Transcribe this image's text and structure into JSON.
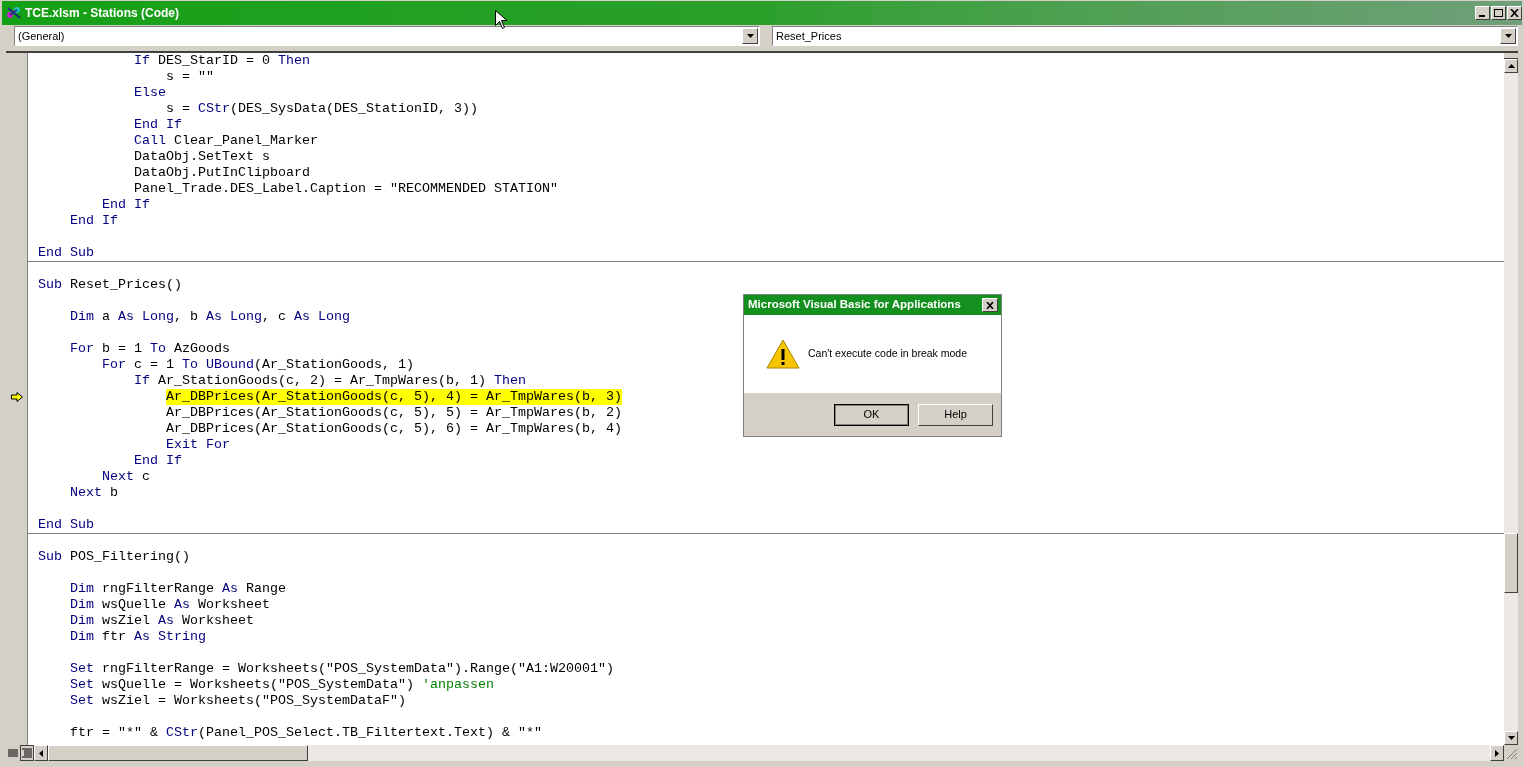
{
  "window": {
    "title": "TCE.xlsm - Stations (Code)"
  },
  "object_box": {
    "value": "(General)"
  },
  "procedure_box": {
    "value": "Reset_Prices"
  },
  "procedures": [
    {
      "lines": [
        {
          "current": false,
          "segments": [
            {
              "kind": "keyword",
              "text": "            If "
            },
            {
              "kind": "plain",
              "text": "DES_StarID = 0 "
            },
            {
              "kind": "keyword",
              "text": "Then"
            }
          ]
        },
        {
          "current": false,
          "segments": [
            {
              "kind": "plain",
              "text": "                s = \"\""
            }
          ]
        },
        {
          "current": false,
          "segments": [
            {
              "kind": "keyword",
              "text": "            Else"
            }
          ]
        },
        {
          "current": false,
          "segments": [
            {
              "kind": "plain",
              "text": "                s = "
            },
            {
              "kind": "keyword",
              "text": "CStr"
            },
            {
              "kind": "plain",
              "text": "(DES_SysData(DES_StationID, 3))"
            }
          ]
        },
        {
          "current": false,
          "segments": [
            {
              "kind": "keyword",
              "text": "            End If"
            }
          ]
        },
        {
          "current": false,
          "segments": [
            {
              "kind": "keyword",
              "text": "            Call "
            },
            {
              "kind": "plain",
              "text": "Clear_Panel_Marker"
            }
          ]
        },
        {
          "current": false,
          "segments": [
            {
              "kind": "plain",
              "text": "            DataObj.SetText s"
            }
          ]
        },
        {
          "current": false,
          "segments": [
            {
              "kind": "plain",
              "text": "            DataObj.PutInClipboard"
            }
          ]
        },
        {
          "current": false,
          "segments": [
            {
              "kind": "plain",
              "text": "            Panel_Trade.DES_Label.Caption = \"RECOMMENDED STATION\""
            }
          ]
        },
        {
          "current": false,
          "segments": [
            {
              "kind": "keyword",
              "text": "        End If"
            }
          ]
        },
        {
          "current": false,
          "segments": [
            {
              "kind": "keyword",
              "text": "    End If"
            }
          ]
        },
        {
          "gap_before": true,
          "current": false,
          "segments": [
            {
              "kind": "keyword",
              "text": "End Sub"
            }
          ]
        }
      ]
    },
    {
      "lines": [
        {
          "gap_before": true,
          "current": false,
          "segments": [
            {
              "kind": "keyword",
              "text": "Sub "
            },
            {
              "kind": "plain",
              "text": "Reset_Prices()"
            }
          ]
        },
        {
          "gap_before": true,
          "current": false,
          "segments": [
            {
              "kind": "keyword",
              "text": "    Dim "
            },
            {
              "kind": "plain",
              "text": "a "
            },
            {
              "kind": "keyword",
              "text": "As Long"
            },
            {
              "kind": "plain",
              "text": ", b "
            },
            {
              "kind": "keyword",
              "text": "As Long"
            },
            {
              "kind": "plain",
              "text": ", c "
            },
            {
              "kind": "keyword",
              "text": "As Long"
            }
          ]
        },
        {
          "gap_before": true,
          "current": false,
          "segments": [
            {
              "kind": "keyword",
              "text": "    For "
            },
            {
              "kind": "plain",
              "text": "b = 1 "
            },
            {
              "kind": "keyword",
              "text": "To "
            },
            {
              "kind": "plain",
              "text": "AzGoods"
            }
          ]
        },
        {
          "current": false,
          "segments": [
            {
              "kind": "keyword",
              "text": "        For "
            },
            {
              "kind": "plain",
              "text": "c = 1 "
            },
            {
              "kind": "keyword",
              "text": "To UBound"
            },
            {
              "kind": "plain",
              "text": "(Ar_StationGoods, 1)"
            }
          ]
        },
        {
          "current": false,
          "segments": [
            {
              "kind": "keyword",
              "text": "            If "
            },
            {
              "kind": "plain",
              "text": "Ar_StationGoods(c, 2) = Ar_TmpWares(b, 1) "
            },
            {
              "kind": "keyword",
              "text": "Then"
            }
          ]
        },
        {
          "current": true,
          "segments": [
            {
              "kind": "plain",
              "text": "                Ar_DBPrices(Ar_StationGoods(c, 5), 4) = Ar_TmpWares(b, 3)"
            }
          ]
        },
        {
          "current": false,
          "segments": [
            {
              "kind": "plain",
              "text": "                Ar_DBPrices(Ar_StationGoods(c, 5), 5) = Ar_TmpWares(b, 2)"
            }
          ]
        },
        {
          "current": false,
          "segments": [
            {
              "kind": "plain",
              "text": "                Ar_DBPrices(Ar_StationGoods(c, 5), 6) = Ar_TmpWares(b, 4)"
            }
          ]
        },
        {
          "current": false,
          "segments": [
            {
              "kind": "keyword",
              "text": "                Exit For"
            }
          ]
        },
        {
          "current": false,
          "segments": [
            {
              "kind": "keyword",
              "text": "            End If"
            }
          ]
        },
        {
          "current": false,
          "segments": [
            {
              "kind": "keyword",
              "text": "        Next "
            },
            {
              "kind": "plain",
              "text": "c"
            }
          ]
        },
        {
          "current": false,
          "segments": [
            {
              "kind": "keyword",
              "text": "    Next "
            },
            {
              "kind": "plain",
              "text": "b"
            }
          ]
        },
        {
          "gap_before": true,
          "current": false,
          "segments": [
            {
              "kind": "keyword",
              "text": "End Sub"
            }
          ]
        }
      ]
    },
    {
      "lines": [
        {
          "gap_before": true,
          "current": false,
          "segments": [
            {
              "kind": "keyword",
              "text": "Sub "
            },
            {
              "kind": "plain",
              "text": "POS_Filtering()"
            }
          ]
        },
        {
          "gap_before": true,
          "current": false,
          "segments": [
            {
              "kind": "keyword",
              "text": "    Dim "
            },
            {
              "kind": "plain",
              "text": "rngFilterRange "
            },
            {
              "kind": "keyword",
              "text": "As "
            },
            {
              "kind": "plain",
              "text": "Range"
            }
          ]
        },
        {
          "current": false,
          "segments": [
            {
              "kind": "keyword",
              "text": "    Dim "
            },
            {
              "kind": "plain",
              "text": "wsQuelle "
            },
            {
              "kind": "keyword",
              "text": "As "
            },
            {
              "kind": "plain",
              "text": "Worksheet"
            }
          ]
        },
        {
          "current": false,
          "segments": [
            {
              "kind": "keyword",
              "text": "    Dim "
            },
            {
              "kind": "plain",
              "text": "wsZiel "
            },
            {
              "kind": "keyword",
              "text": "As "
            },
            {
              "kind": "plain",
              "text": "Worksheet"
            }
          ]
        },
        {
          "current": false,
          "segments": [
            {
              "kind": "keyword",
              "text": "    Dim "
            },
            {
              "kind": "plain",
              "text": "ftr "
            },
            {
              "kind": "keyword",
              "text": "As String"
            }
          ]
        },
        {
          "gap_before": true,
          "current": false,
          "segments": [
            {
              "kind": "keyword",
              "text": "    Set "
            },
            {
              "kind": "plain",
              "text": "rngFilterRange = Worksheets(\"POS_SystemData\").Range(\"A1:W20001\")"
            }
          ]
        },
        {
          "current": false,
          "segments": [
            {
              "kind": "keyword",
              "text": "    Set "
            },
            {
              "kind": "plain",
              "text": "wsQuelle = Worksheets(\"POS_SystemData\") "
            },
            {
              "kind": "comment",
              "text": "'anpassen"
            }
          ]
        },
        {
          "current": false,
          "segments": [
            {
              "kind": "keyword",
              "text": "    Set "
            },
            {
              "kind": "plain",
              "text": "wsZiel = Worksheets(\"POS_SystemDataF\")"
            }
          ]
        },
        {
          "gap_before": true,
          "current": false,
          "segments": [
            {
              "kind": "plain",
              "text": "    ftr = \"*\" & "
            },
            {
              "kind": "keyword",
              "text": "CStr"
            },
            {
              "kind": "plain",
              "text": "(Panel_POS_Select.TB_Filtertext.Text) & \"*\""
            }
          ]
        }
      ]
    }
  ],
  "dialog": {
    "title": "Microsoft Visual Basic for Applications",
    "message": "Can't execute code in break mode",
    "buttons": [
      "OK",
      "Help"
    ]
  }
}
